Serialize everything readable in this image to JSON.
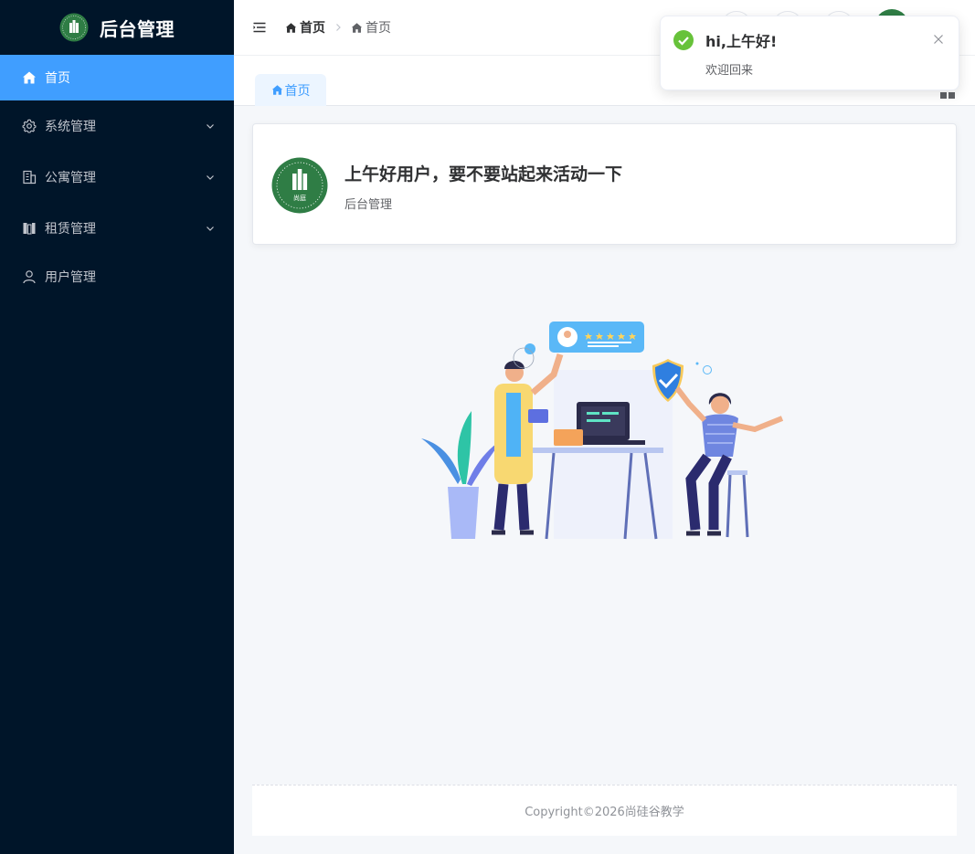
{
  "brand": {
    "title": "后台管理",
    "logo_text": "尚庭"
  },
  "menu": [
    {
      "label": "首页",
      "icon": "home-icon",
      "active": true
    },
    {
      "label": "系统管理",
      "icon": "gear-icon",
      "has_children": true
    },
    {
      "label": "公寓管理",
      "icon": "building-icon",
      "has_children": true
    },
    {
      "label": "租赁管理",
      "icon": "lease-icon",
      "has_children": true
    },
    {
      "label": "用户管理",
      "icon": "user-icon",
      "has_children": false
    }
  ],
  "breadcrumb": [
    {
      "label": "首页"
    },
    {
      "label": "首页"
    }
  ],
  "tabs": [
    {
      "label": "首页"
    }
  ],
  "welcome": {
    "title": "上午好用户，要不要站起来活动一下",
    "subtitle": "后台管理"
  },
  "footer": {
    "copyright": "Copyright©2026尚硅谷教学"
  },
  "notification": {
    "title": "hi,上午好!",
    "message": "欢迎回来"
  },
  "colors": {
    "sidebar_bg": "#001529",
    "accent": "#409eff",
    "success": "#67c23a",
    "brand_green": "#2f7d45"
  }
}
